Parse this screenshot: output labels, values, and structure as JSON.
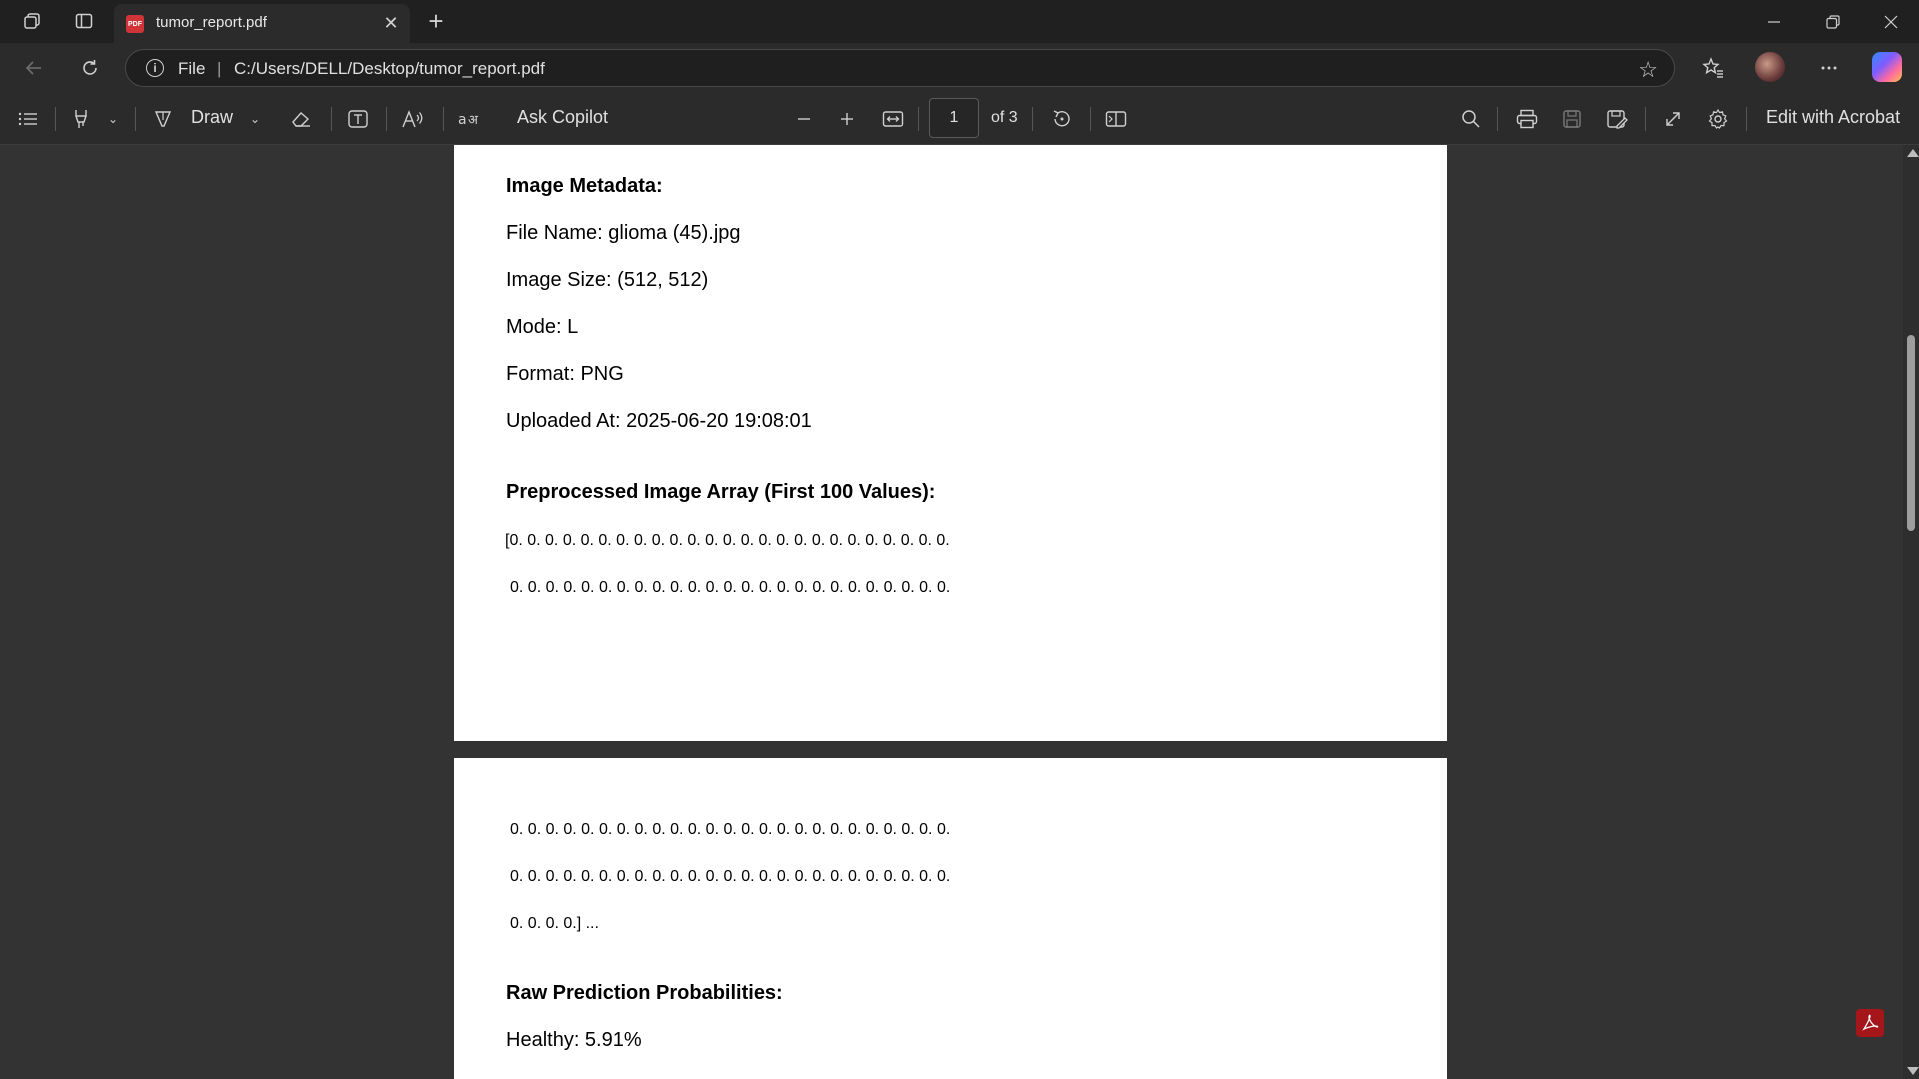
{
  "tab": {
    "title": "tumor_report.pdf",
    "favicon_label": "PDF"
  },
  "address": {
    "scheme_label": "File",
    "separator": "|",
    "url": "C:/Users/DELL/Desktop/tumor_report.pdf"
  },
  "toolbar": {
    "draw_label": "Draw",
    "ask_copilot_label": "Ask Copilot",
    "page_current": "1",
    "page_total": "of 3",
    "edit_acrobat_label": "Edit with Acrobat"
  },
  "document": {
    "page1": {
      "metadata_heading": "Image Metadata:",
      "file_name": "File Name: glioma (45).jpg",
      "image_size": "Image Size: (512, 512)",
      "mode": "Mode: L",
      "format": "Format: PNG",
      "uploaded_at": "Uploaded At: 2025-06-20 19:08:01",
      "array_heading": "Preprocessed Image Array (First 100 Values):",
      "array_line1": "[0. 0. 0. 0. 0. 0. 0. 0. 0. 0. 0. 0. 0. 0. 0. 0. 0. 0. 0. 0. 0. 0. 0. 0. 0.",
      "array_line2": "0. 0. 0. 0. 0. 0. 0. 0. 0. 0. 0. 0. 0. 0. 0. 0. 0. 0. 0. 0. 0. 0. 0. 0. 0."
    },
    "page2": {
      "array_line3": "0. 0. 0. 0. 0. 0. 0. 0. 0. 0. 0. 0. 0. 0. 0. 0. 0. 0. 0. 0. 0. 0. 0. 0. 0.",
      "array_line4": "0. 0. 0. 0. 0. 0. 0. 0. 0. 0. 0. 0. 0. 0. 0. 0. 0. 0. 0. 0. 0. 0. 0. 0. 0.",
      "array_line5": "0. 0. 0. 0.] ...",
      "probabilities_heading": "Raw Prediction Probabilities:",
      "healthy": "Healthy: 5.91%"
    }
  }
}
